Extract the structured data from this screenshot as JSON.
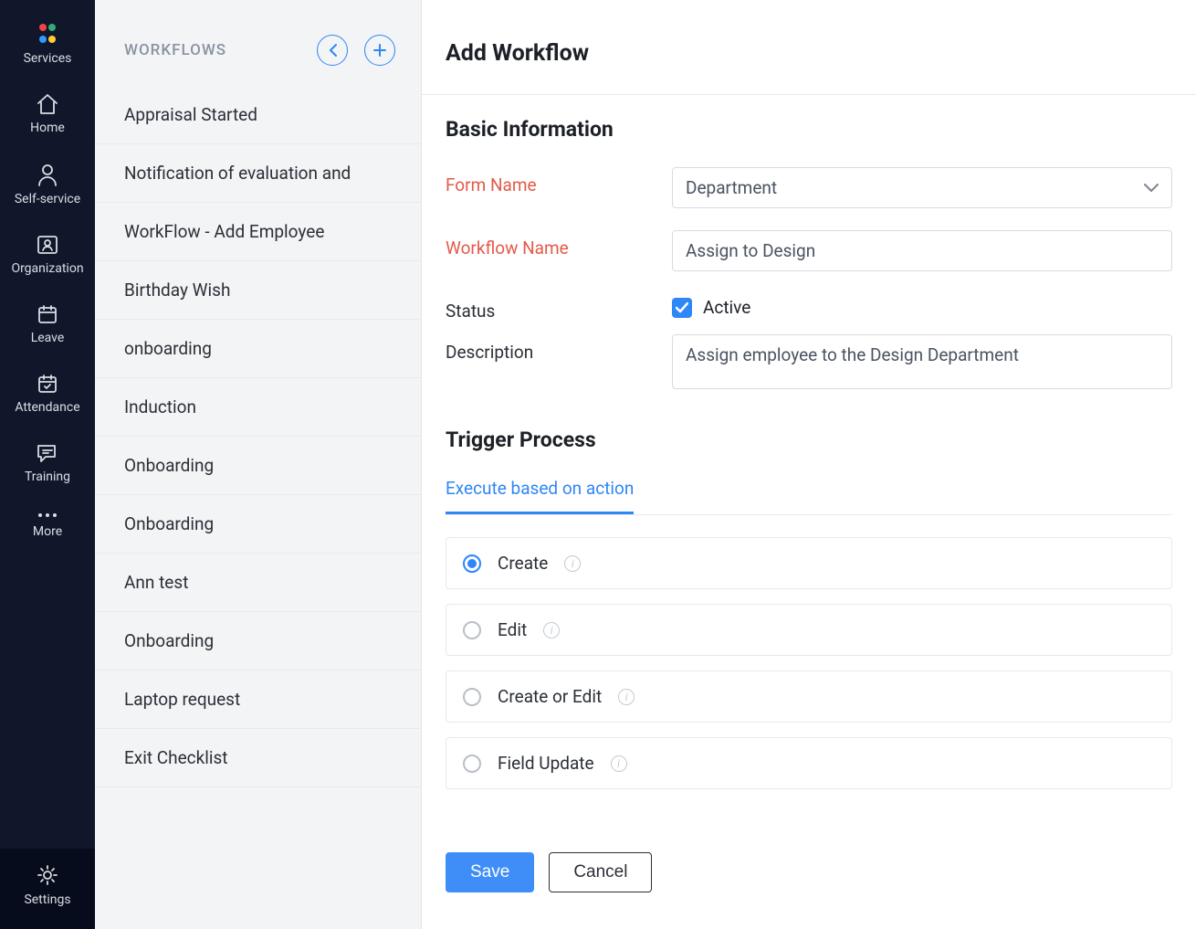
{
  "nav": {
    "items": [
      {
        "id": "services",
        "label": "Services",
        "icon": "apps"
      },
      {
        "id": "home",
        "label": "Home",
        "icon": "home"
      },
      {
        "id": "self-service",
        "label": "Self-service",
        "icon": "person"
      },
      {
        "id": "organization",
        "label": "Organization",
        "icon": "org"
      },
      {
        "id": "leave",
        "label": "Leave",
        "icon": "calendar"
      },
      {
        "id": "attendance",
        "label": "Attendance",
        "icon": "calcheck"
      },
      {
        "id": "training",
        "label": "Training",
        "icon": "chat"
      },
      {
        "id": "more",
        "label": "More",
        "icon": "dots"
      },
      {
        "id": "settings",
        "label": "Settings",
        "icon": "gear",
        "active": true
      }
    ]
  },
  "sidelist": {
    "title": "WORKFLOWS",
    "items": [
      "Appraisal Started",
      "Notification of evaluation and",
      "WorkFlow - Add Employee",
      "Birthday Wish",
      "onboarding",
      "Induction",
      "Onboarding",
      "Onboarding",
      "Ann test",
      "Onboarding",
      "Laptop request",
      "Exit Checklist"
    ]
  },
  "main": {
    "title": "Add Workflow",
    "basic": {
      "heading": "Basic Information",
      "form_name_label": "Form Name",
      "form_name_value": "Department",
      "workflow_name_label": "Workflow Name",
      "workflow_name_value": "Assign to Design",
      "status_label": "Status",
      "active_label": "Active",
      "active_checked": true,
      "description_label": "Description",
      "description_value": "Assign employee to the Design Department"
    },
    "trigger": {
      "heading": "Trigger Process",
      "tab": "Execute based on action",
      "options": [
        {
          "label": "Create",
          "selected": true
        },
        {
          "label": "Edit",
          "selected": false
        },
        {
          "label": "Create or Edit",
          "selected": false
        },
        {
          "label": "Field Update",
          "selected": false
        }
      ]
    },
    "buttons": {
      "save": "Save",
      "cancel": "Cancel"
    }
  }
}
